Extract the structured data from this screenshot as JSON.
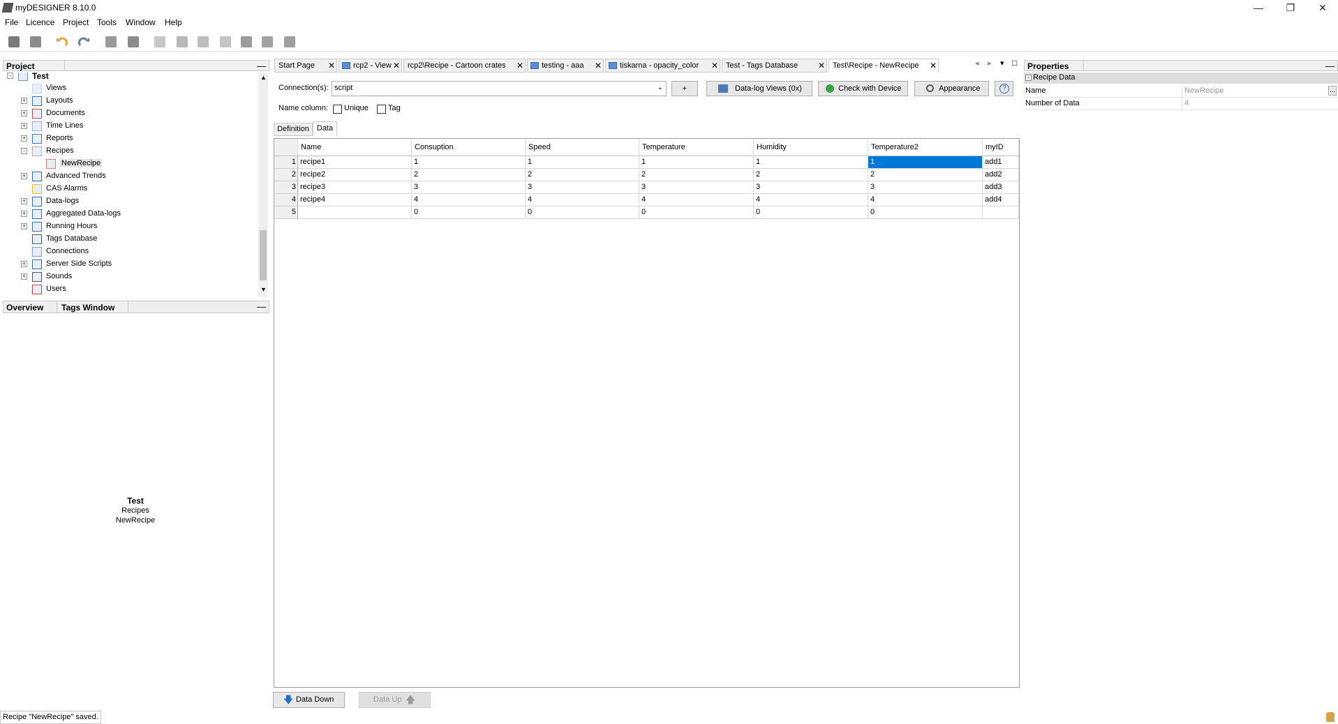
{
  "window": {
    "title": "myDESIGNER 8.10.0",
    "minimize_glyph": "—",
    "maximize_glyph": "❐",
    "close_glyph": "✕"
  },
  "menu": [
    "File",
    "Licence",
    "Project",
    "Tools",
    "Window",
    "Help"
  ],
  "toolbar": {
    "icons": [
      "save-icon",
      "save-all-icon",
      "undo-icon",
      "redo-icon",
      "add-item-icon",
      "remove-item-icon",
      "document-icon",
      "add-row-icon",
      "copy-icon",
      "delete-icon",
      "import-icon",
      "export-icon",
      "settings-icon"
    ],
    "colors": {
      "undo": "#e8a33c",
      "redo": "#6b7f9a",
      "gray": "#8a8a8a"
    }
  },
  "project_panel": {
    "title": "Project",
    "minimize": "—",
    "tree": [
      {
        "label": "Test",
        "level": 0,
        "bold": true,
        "expander": "-"
      },
      {
        "label": "Views",
        "level": 1,
        "expander": ""
      },
      {
        "label": "Layouts",
        "level": 1,
        "expander": "+"
      },
      {
        "label": "Documents",
        "level": 1,
        "expander": "+"
      },
      {
        "label": "Time Lines",
        "level": 1,
        "expander": "+"
      },
      {
        "label": "Reports",
        "level": 1,
        "expander": "+"
      },
      {
        "label": "Recipes",
        "level": 1,
        "expander": "-"
      },
      {
        "label": "NewRecipe",
        "level": 2,
        "expander": "",
        "selected": true
      },
      {
        "label": "Advanced Trends",
        "level": 1,
        "expander": "+"
      },
      {
        "label": "CAS Alarms",
        "level": 1,
        "expander": ""
      },
      {
        "label": "Data-logs",
        "level": 1,
        "expander": "+"
      },
      {
        "label": "Aggregated Data-logs",
        "level": 1,
        "expander": "+"
      },
      {
        "label": "Running Hours",
        "level": 1,
        "expander": "+"
      },
      {
        "label": "Tags Database",
        "level": 1,
        "expander": ""
      },
      {
        "label": "Connections",
        "level": 1,
        "expander": ""
      },
      {
        "label": "Server Side Scripts",
        "level": 1,
        "expander": "+"
      },
      {
        "label": "Sounds",
        "level": 1,
        "expander": "+"
      },
      {
        "label": "Users",
        "level": 1,
        "expander": ""
      }
    ]
  },
  "overview_panel": {
    "tabs": [
      "Overview",
      "Tags Window"
    ],
    "minimize": "—",
    "lines": [
      "Test",
      "Recipes",
      "NewRecipe"
    ]
  },
  "doc_tabs": [
    {
      "label": "Start Page",
      "icon": false
    },
    {
      "label": "rcp2 - View",
      "icon": true
    },
    {
      "label": "rcp2\\Recipe - Cartoon crates",
      "icon": false
    },
    {
      "label": "testing - aaa",
      "icon": true
    },
    {
      "label": "tiskarna - opacity_color",
      "icon": true
    },
    {
      "label": "Test - Tags Database",
      "icon": false
    },
    {
      "label": "Test\\Recipe - NewRecipe",
      "icon": false,
      "active": true
    }
  ],
  "tab_close": "✕",
  "tab_nav": [
    "◂",
    "▸",
    "▾",
    "□"
  ],
  "editor": {
    "connections_label": "Connection(s):",
    "connection_value": "script",
    "add_button": "+",
    "datalog_button": "Data-log Views (0x)",
    "check_button": "Check with Device",
    "appearance_button": "Appearance",
    "help_button": "?",
    "name_column_label": "Name column:",
    "unique_label": "Unique",
    "tag_label": "Tag",
    "subtabs": [
      "Definition",
      "Data"
    ],
    "active_subtab": "Data"
  },
  "table": {
    "columns": [
      "Name",
      "Consuption",
      "Speed",
      "Temperature",
      "Humidity",
      "Temperature2",
      "myID"
    ],
    "rows": [
      {
        "num": "1",
        "cells": [
          "recipe1",
          "1",
          "1",
          "1",
          "1",
          "1",
          "add1"
        ]
      },
      {
        "num": "2",
        "cells": [
          "recipe2",
          "2",
          "2",
          "2",
          "2",
          "2",
          "add2"
        ]
      },
      {
        "num": "3",
        "cells": [
          "recipe3",
          "3",
          "3",
          "3",
          "3",
          "3",
          "add3"
        ]
      },
      {
        "num": "4",
        "cells": [
          "recipe4",
          "4",
          "4",
          "4",
          "4",
          "4",
          "add4"
        ]
      },
      {
        "num": "5",
        "cells": [
          "",
          "0",
          "0",
          "0",
          "0",
          "0",
          ""
        ]
      }
    ],
    "selected_cell": {
      "row": 0,
      "col": 5
    }
  },
  "bottom_buttons": {
    "data_down": "Data Down",
    "data_up": "Data Up"
  },
  "properties": {
    "title": "Properties",
    "minimize": "—",
    "section": "Recipe Data",
    "rows": [
      {
        "key": "Name",
        "value": "NewRecipe"
      },
      {
        "key": "Number of Data",
        "value": "4"
      }
    ],
    "ellipsis": "..."
  },
  "status": {
    "message": "Recipe \"NewRecipe\" saved."
  }
}
